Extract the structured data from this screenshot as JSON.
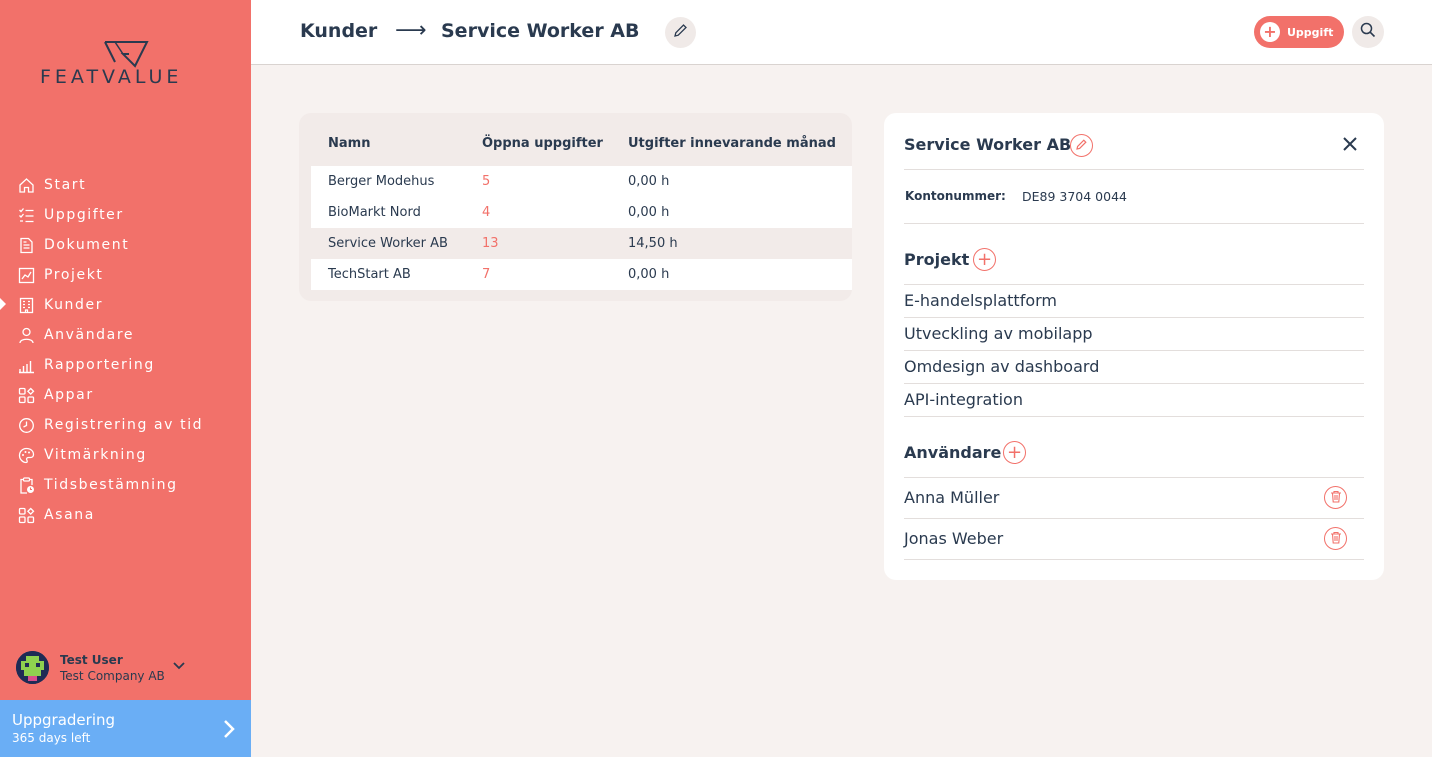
{
  "brand": {
    "name": "FEATVALUE",
    "accent": "#f2716a",
    "dark": "#2a3a4f",
    "upgrade_color": "#6aaef5"
  },
  "sidebar": {
    "items": [
      {
        "label": "Start",
        "icon": "home-icon"
      },
      {
        "label": "Uppgifter",
        "icon": "checklist-icon"
      },
      {
        "label": "Dokument",
        "icon": "document-icon"
      },
      {
        "label": "Projekt",
        "icon": "chart-icon"
      },
      {
        "label": "Kunder",
        "icon": "building-icon",
        "active": true
      },
      {
        "label": "Användare",
        "icon": "user-icon"
      },
      {
        "label": "Rapportering",
        "icon": "bar-chart-icon"
      },
      {
        "label": "Appar",
        "icon": "apps-icon"
      },
      {
        "label": "Registrering av tid",
        "icon": "timer-icon"
      },
      {
        "label": "Vitmärkning",
        "icon": "palette-icon"
      },
      {
        "label": "Tidsbestämning",
        "icon": "clipboard-clock-icon"
      },
      {
        "label": "Asana",
        "icon": "apps-icon"
      }
    ],
    "user": {
      "name": "Test User",
      "company": "Test Company AB"
    },
    "upgrade": {
      "title": "Uppgradering",
      "subtitle": "365 days left"
    }
  },
  "header": {
    "breadcrumb_root": "Kunder",
    "breadcrumb_arrow": "⟶",
    "breadcrumb_current": "Service Worker AB",
    "task_button": "Uppgift"
  },
  "table": {
    "headers": [
      "Namn",
      "Öppna uppgifter",
      "Utgifter innevarande månad"
    ],
    "rows": [
      {
        "name": "Berger Modehus",
        "open": "5",
        "expenses": "0,00 h"
      },
      {
        "name": "BioMarkt Nord",
        "open": "4",
        "expenses": "0,00 h"
      },
      {
        "name": "Service Worker AB",
        "open": "13",
        "expenses": "14,50 h"
      },
      {
        "name": "TechStart AB",
        "open": "7",
        "expenses": "0,00 h"
      }
    ]
  },
  "detail": {
    "title": "Service Worker AB",
    "account_label": "Kontonummer:",
    "account_value": "DE89 3704 0044",
    "projects_title": "Projekt",
    "projects": [
      "E-handelsplattform",
      "Utveckling av mobilapp",
      "Omdesign av dashboard",
      "API-integration"
    ],
    "users_title": "Användare",
    "users": [
      "Anna Müller",
      "Jonas Weber"
    ]
  }
}
